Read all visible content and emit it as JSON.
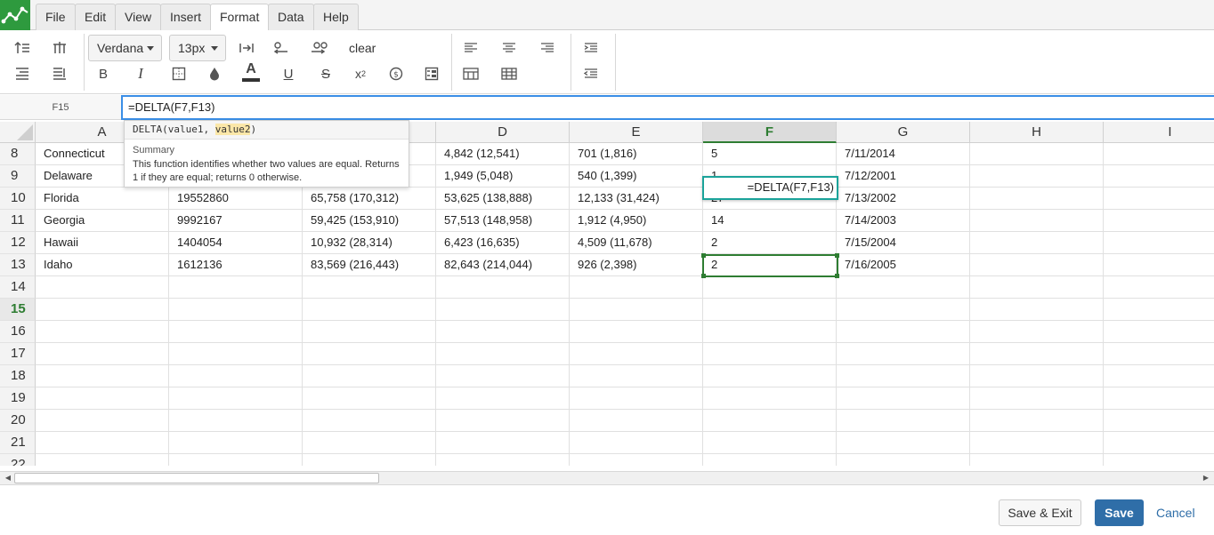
{
  "menu": {
    "items": [
      "File",
      "Edit",
      "View",
      "Insert",
      "Format",
      "Data",
      "Help"
    ],
    "active": "Format"
  },
  "toolbar": {
    "font": "Verdana",
    "size": "13px",
    "clear_label": "clear"
  },
  "formula_bar": {
    "cell_ref": "F15",
    "formula": "=DELTA(F7,F13)"
  },
  "tooltip": {
    "sig_fn": "DELTA(",
    "sig_arg1": "value1, ",
    "sig_arg2": "value2",
    "sig_close": ")",
    "summary_label": "Summary",
    "description": "This function identifies whether two values are equal. Returns 1 if they are equal; returns 0 otherwise."
  },
  "grid": {
    "columns": [
      "A",
      "B",
      "C",
      "D",
      "E",
      "F",
      "G",
      "H",
      "I"
    ],
    "selected_column": "F",
    "rows": [
      {
        "num": "8",
        "cells": [
          "Connecticut",
          "",
          "",
          "4,842 (12,541)",
          "701 (1,816)",
          "5",
          "7/11/2014",
          "",
          ""
        ]
      },
      {
        "num": "9",
        "cells": [
          "Delaware",
          "",
          "",
          "1,949 (5,048)",
          "540 (1,399)",
          "1",
          "7/12/2001",
          "",
          ""
        ]
      },
      {
        "num": "10",
        "cells": [
          "Florida",
          "19552860",
          "65,758 (170,312)",
          "53,625 (138,888)",
          "12,133 (31,424)",
          "27",
          "7/13/2002",
          "",
          ""
        ]
      },
      {
        "num": "11",
        "cells": [
          "Georgia",
          "9992167",
          "59,425 (153,910)",
          "57,513 (148,958)",
          "1,912 (4,950)",
          "14",
          "7/14/2003",
          "",
          ""
        ]
      },
      {
        "num": "12",
        "cells": [
          "Hawaii",
          "1404054",
          "10,932 (28,314)",
          "6,423 (16,635)",
          "4,509 (11,678)",
          "2",
          "7/15/2004",
          "",
          ""
        ]
      },
      {
        "num": "13",
        "cells": [
          "Idaho",
          "1612136",
          "83,569 (216,443)",
          "82,643 (214,044)",
          "926 (2,398)",
          "2",
          "7/16/2005",
          "",
          ""
        ]
      },
      {
        "num": "14",
        "cells": [
          "",
          "",
          "",
          "",
          "",
          "",
          "",
          "",
          ""
        ]
      },
      {
        "num": "15",
        "cells": [
          "",
          "",
          "",
          "",
          "",
          "",
          "",
          "",
          ""
        ]
      },
      {
        "num": "16",
        "cells": [
          "",
          "",
          "",
          "",
          "",
          "",
          "",
          "",
          ""
        ]
      },
      {
        "num": "17",
        "cells": [
          "",
          "",
          "",
          "",
          "",
          "",
          "",
          "",
          ""
        ]
      },
      {
        "num": "18",
        "cells": [
          "",
          "",
          "",
          "",
          "",
          "",
          "",
          "",
          ""
        ]
      },
      {
        "num": "19",
        "cells": [
          "",
          "",
          "",
          "",
          "",
          "",
          "",
          "",
          ""
        ]
      },
      {
        "num": "20",
        "cells": [
          "",
          "",
          "",
          "",
          "",
          "",
          "",
          "",
          ""
        ]
      },
      {
        "num": "21",
        "cells": [
          "",
          "",
          "",
          "",
          "",
          "",
          "",
          "",
          ""
        ]
      },
      {
        "num": "22",
        "cells": [
          "",
          "",
          "",
          "",
          "",
          "",
          "",
          "",
          ""
        ]
      }
    ],
    "selected_row": "15",
    "editing_value": "=DELTA(F7,F13)"
  },
  "footer": {
    "save_exit": "Save & Exit",
    "save": "Save",
    "cancel": "Cancel"
  },
  "colors": {
    "accent_green": "#2e7d32",
    "primary_blue": "#2f6ea8",
    "edit_teal": "#1aa39a"
  }
}
